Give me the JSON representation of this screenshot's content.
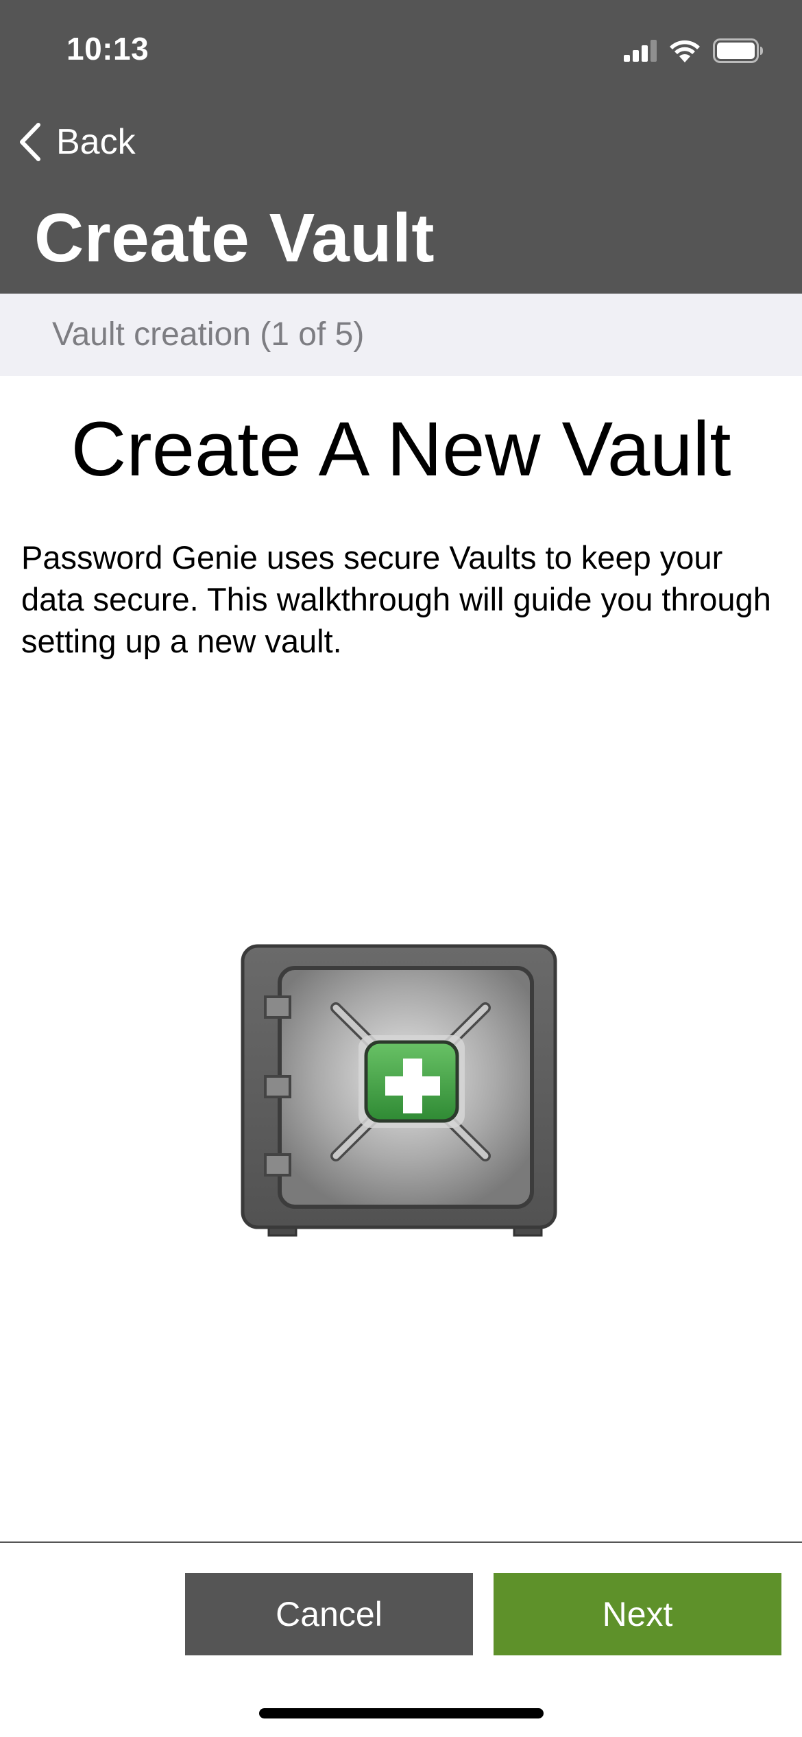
{
  "status_bar": {
    "time": "10:13",
    "signal_icon": "cellular-signal-icon",
    "wifi_icon": "wifi-icon",
    "battery_icon": "battery-icon"
  },
  "nav": {
    "back_label": "Back",
    "back_icon": "chevron-left-icon",
    "title": "Create Vault"
  },
  "section": {
    "label": "Vault creation (1 of 5)"
  },
  "content": {
    "heading": "Create A New Vault",
    "description": "Password Genie uses secure Vaults to keep your data secure. This walkthrough will guide you through setting up a new vault.",
    "illustration_icon": "vault-add-icon"
  },
  "footer": {
    "cancel_label": "Cancel",
    "next_label": "Next"
  },
  "colors": {
    "header_background": "#555555",
    "section_background": "#f0f0f5",
    "section_text": "#7d7d82",
    "cancel_button": "#555555",
    "next_button": "#5e912a",
    "vault_plus_green": "#3f9a3f"
  }
}
